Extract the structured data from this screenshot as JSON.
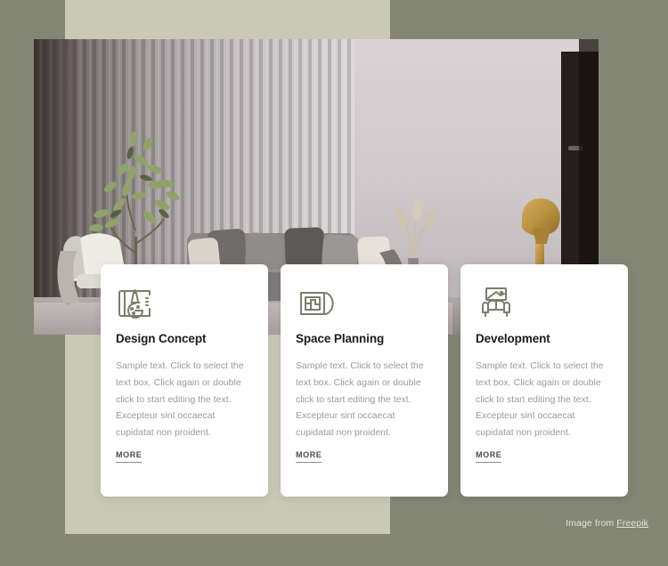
{
  "page": {
    "background_color": "#838675",
    "panel_color": "#c9c9b5",
    "accent_color": "#7b7e6b"
  },
  "hero": {
    "name": "living-room-interior-photo",
    "alt": "Modern living room with grey sofa, olive plant, slatted wall and gold lamp"
  },
  "cards": [
    {
      "icon": "design-concept-icon",
      "title": "Design Concept",
      "body": "Sample text. Click to select the text box. Click again or double click to start editing the text. Excepteur sint occaecat cupidatat non proident.",
      "link_label": "MORE"
    },
    {
      "icon": "space-planning-icon",
      "title": "Space Planning",
      "body": "Sample text. Click to select the text box. Click again or double click to start editing the text. Excepteur sint occaecat cupidatat non proident.",
      "link_label": "MORE"
    },
    {
      "icon": "development-icon",
      "title": "Development",
      "body": "Sample text. Click to select the text box. Click again or double click to start editing the text. Excepteur sint occaecat cupidatat non proident.",
      "link_label": "MORE"
    }
  ],
  "credit": {
    "prefix": "Image from ",
    "link_label": "Freepik"
  }
}
